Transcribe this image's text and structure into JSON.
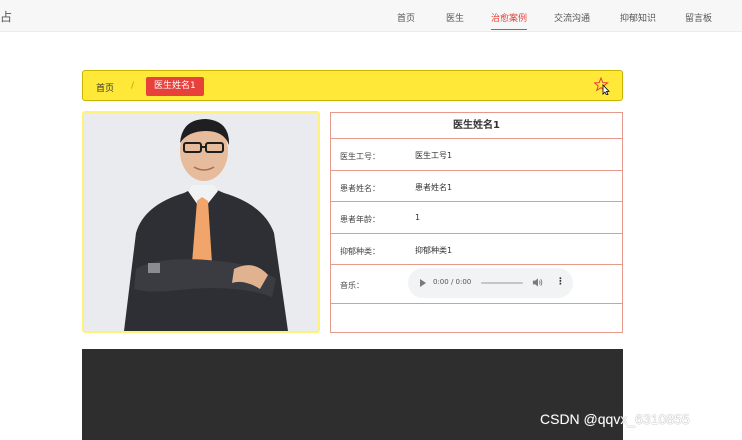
{
  "site": {
    "title_fragment": "占"
  },
  "nav": {
    "items": [
      {
        "label": "首页"
      },
      {
        "label": "医生"
      },
      {
        "label": "治愈案例",
        "active": true
      },
      {
        "label": "交流沟通"
      },
      {
        "label": "抑郁知识"
      },
      {
        "label": "留言板"
      }
    ]
  },
  "breadcrumb": {
    "home": "首页",
    "separator": "/",
    "current": "医生姓名1"
  },
  "colors": {
    "accent": "#e8403b",
    "breadcrumb_bg": "#ffe838",
    "border": "#e59a8c",
    "footer": "#2e2e2e"
  },
  "icons": {
    "favorite": "star-icon"
  },
  "detail": {
    "name": "医生姓名1",
    "rows": [
      {
        "label": "医生工号：",
        "value": "医生工号1"
      },
      {
        "label": "患者姓名：",
        "value": "患者姓名1"
      },
      {
        "label": "患者年龄：",
        "value": "1"
      },
      {
        "label": "抑郁种类：",
        "value": "抑郁种类1"
      }
    ],
    "music_label": "音乐：",
    "player_time": "0:00 / 0:00"
  },
  "watermark": "CSDN @qqvx_6310855"
}
